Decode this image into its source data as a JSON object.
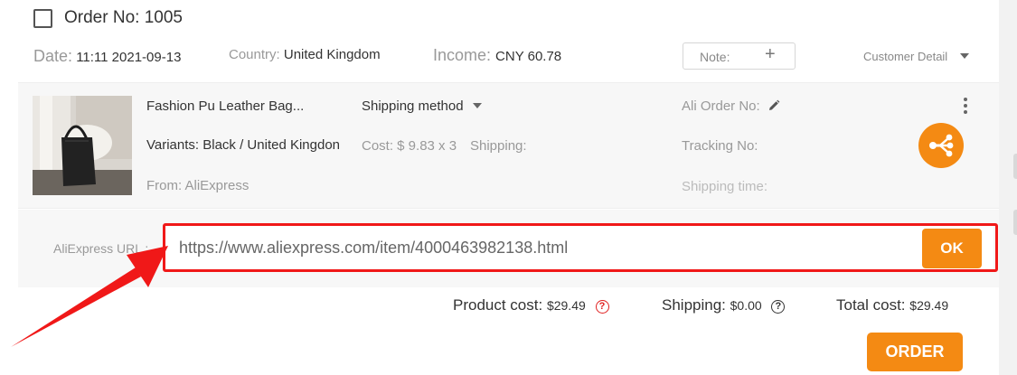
{
  "order": {
    "title": "Order No: 1005",
    "date_label": "Date:",
    "date_value": "11:11 2021-09-13",
    "country_label": "Country:",
    "country_value": "United Kingdom",
    "income_label": "Income:",
    "income_value": "CNY 60.78",
    "note_label": "Note:",
    "note_plus": "+",
    "customer_detail_label": "Customer Detail"
  },
  "product": {
    "name": "Fashion Pu Leather Bag...",
    "variants": "Variants: Black / United Kingdon",
    "from": "From: AliExpress",
    "shipping_method_label": "Shipping method",
    "cost": "Cost: $ 9.83 x 3",
    "shipping_label": "Shipping:",
    "ali_order_label": "Ali Order No:",
    "tracking_label": "Tracking No:",
    "shipping_time_label": "Shipping time:"
  },
  "aliexpress_url": {
    "label": "AliExpress URL :",
    "value": "https://www.aliexpress.com/item/4000463982138.html",
    "ok_label": "OK"
  },
  "totals": {
    "product_cost_label": "Product cost:",
    "product_cost_value": "$29.49",
    "shipping_label": "Shipping:",
    "shipping_value": "$0.00",
    "total_cost_label": "Total cost:",
    "total_cost_value": "$29.49",
    "help_glyph": "?",
    "order_label": "ORDER"
  },
  "colors": {
    "accent_orange": "#f48a13",
    "highlight_red": "#f01818"
  },
  "icons": [
    "checkbox-icon",
    "plus-icon",
    "chevron-down-icon",
    "pencil-icon",
    "more-vertical-icon",
    "share-icon",
    "help-icon",
    "annotation-arrow"
  ]
}
